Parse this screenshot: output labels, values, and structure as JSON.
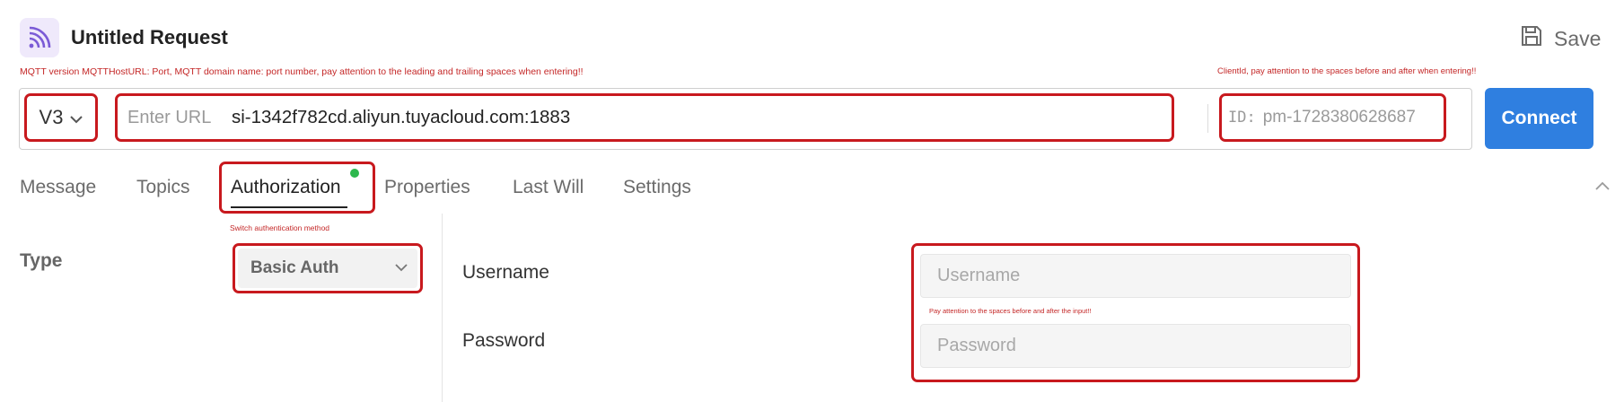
{
  "header": {
    "title": "Untitled Request",
    "save_label": "Save"
  },
  "notes": {
    "url_note": "MQTT version MQTTHostURL: Port, MQTT domain name: port number, pay attention to the leading and trailing spaces when entering!!",
    "client_note": "ClientId, pay attention to the spaces before and after when entering!!",
    "auth_note": "Switch authentication method",
    "creds_note": "Pay attention to the spaces before and after the input!!"
  },
  "request": {
    "version": "V3",
    "url_placeholder": "Enter URL",
    "url_value": "si-1342f782cd.aliyun.tuyacloud.com:1883",
    "id_label": "ID:",
    "client_id": "pm-1728380628687",
    "connect_label": "Connect"
  },
  "tabs": [
    {
      "label": "Message"
    },
    {
      "label": "Topics"
    },
    {
      "label": "Authorization",
      "active": true
    },
    {
      "label": "Properties"
    },
    {
      "label": "Last Will"
    },
    {
      "label": "Settings"
    }
  ],
  "authorization": {
    "type_label": "Type",
    "type_value": "Basic Auth",
    "username_label": "Username",
    "username_placeholder": "Username",
    "password_label": "Password",
    "password_placeholder": "Password"
  },
  "colors": {
    "accent_blue": "#2f7fe0",
    "annotation_red": "#c8191e",
    "status_green": "#2db84d"
  }
}
